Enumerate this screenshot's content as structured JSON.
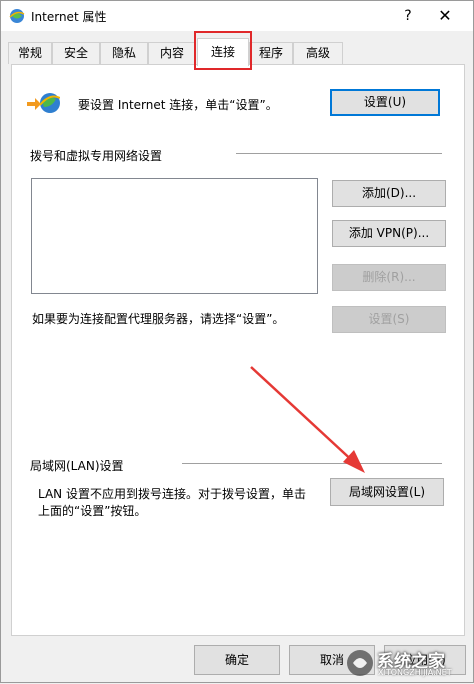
{
  "window": {
    "title": "Internet 属性",
    "help": "?",
    "close": "✕"
  },
  "tabs": [
    {
      "label": "常规"
    },
    {
      "label": "安全"
    },
    {
      "label": "隐私"
    },
    {
      "label": "内容"
    },
    {
      "label": "连接",
      "active": true
    },
    {
      "label": "程序"
    },
    {
      "label": "高级"
    }
  ],
  "setup": {
    "text": "要设置 Internet 连接，单击“设置”。",
    "button": "设置(U)"
  },
  "dialup": {
    "heading": "拨号和虚拟专用网络设置",
    "add_button": "添加(D)...",
    "add_vpn_button": "添加 VPN(P)...",
    "remove_button": "删除(R)...",
    "proxy_text": "如果要为连接配置代理服务器，请选择“设置”。",
    "settings_button": "设置(S)"
  },
  "lan": {
    "heading": "局域网(LAN)设置",
    "text_line1": "LAN 设置不应用到拨号连接。对于拨号设置，单击",
    "text_line2": "上面的“设置”按钮。",
    "button": "局域网设置(L)"
  },
  "footer": {
    "ok": "确定",
    "cancel": "取消",
    "apply": "应用(A)"
  },
  "watermark": {
    "text": "系统之家",
    "url": "XITONGZHIJIA.NET"
  },
  "colors": {
    "highlight_box": "#e0282a",
    "arrow": "#e53935",
    "accent": "#0078d7"
  }
}
